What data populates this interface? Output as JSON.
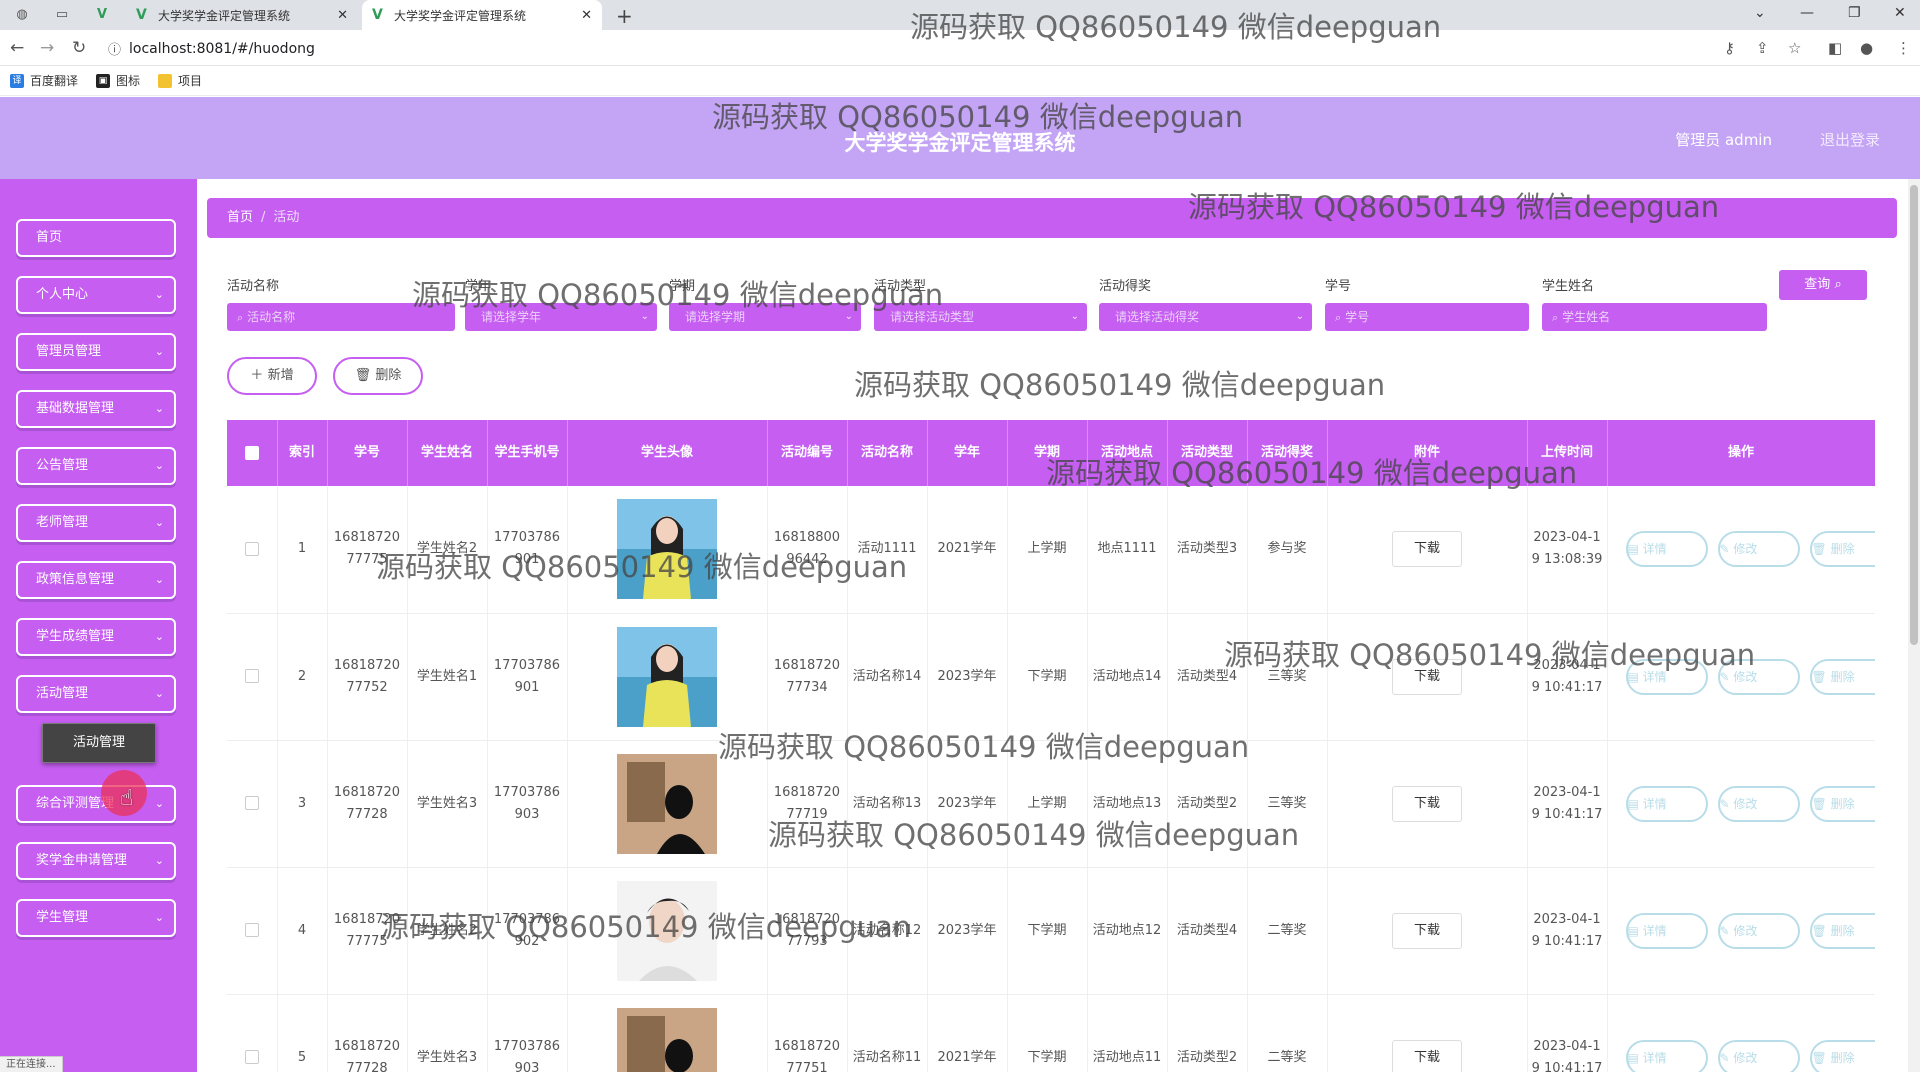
{
  "browser": {
    "tabs": [
      {
        "title": "大学奖学金评定管理系统",
        "close": "✕"
      },
      {
        "title": "大学奖学金评定管理系统",
        "close": "✕"
      }
    ],
    "new_tab": "+",
    "url": "localhost:8081/#/huodong",
    "bookmarks": [
      "百度翻译",
      "图标",
      "项目"
    ]
  },
  "header": {
    "title": "大学奖学金评定管理系统",
    "user": "管理员 admin",
    "logout": "退出登录"
  },
  "sidebar": {
    "items": [
      "首页",
      "个人中心",
      "管理员管理",
      "基础数据管理",
      "公告管理",
      "老师管理",
      "政策信息管理",
      "学生成绩管理",
      "活动管理",
      "综合评测管理",
      "奖学金申请管理",
      "学生管理"
    ],
    "submenu": "活动管理"
  },
  "breadcrumb": {
    "home": "首页",
    "separator": "/",
    "current": "活动"
  },
  "filters": {
    "labels": [
      "活动名称",
      "学年",
      "学期",
      "活动类型",
      "活动得奖",
      "学号",
      "学生姓名"
    ],
    "placeholders": [
      "活动名称",
      "请选择学年",
      "请选择学期",
      "请选择活动类型",
      "请选择活动得奖",
      "学号",
      "学生姓名"
    ],
    "query": "查询"
  },
  "actions": {
    "add": "新增",
    "delete": "删除"
  },
  "table": {
    "headers": [
      "索引",
      "学号",
      "学生姓名",
      "学生手机号",
      "学生头像",
      "活动编号",
      "活动名称",
      "学年",
      "学期",
      "活动地点",
      "活动类型",
      "活动得奖",
      "附件",
      "上传时间",
      "操作"
    ],
    "download_label": "下载",
    "op_labels": [
      "详情",
      "修改",
      "删除"
    ],
    "rows": [
      {
        "index": "1",
        "student_no": "1681872077775",
        "student_name": "学生姓名2",
        "phone": "17703786901",
        "activity_no": "1681880096442",
        "activity_name": "活动1111",
        "year": "2021学年",
        "term": "上学期",
        "place": "地点1111",
        "type": "活动类型3",
        "award": "参与奖",
        "time": "2023-04-19 13:08:39"
      },
      {
        "index": "2",
        "student_no": "1681872077752",
        "student_name": "学生姓名1",
        "phone": "17703786901",
        "activity_no": "1681872077734",
        "activity_name": "活动名称14",
        "year": "2023学年",
        "term": "下学期",
        "place": "活动地点14",
        "type": "活动类型4",
        "award": "三等奖",
        "time": "2023-04-19 10:41:17"
      },
      {
        "index": "3",
        "student_no": "1681872077728",
        "student_name": "学生姓名3",
        "phone": "17703786903",
        "activity_no": "1681872077719",
        "activity_name": "活动名称13",
        "year": "2023学年",
        "term": "上学期",
        "place": "活动地点13",
        "type": "活动类型2",
        "award": "三等奖",
        "time": "2023-04-19 10:41:17"
      },
      {
        "index": "4",
        "student_no": "1681872077775",
        "student_name": "学生姓名2",
        "phone": "17703786902",
        "activity_no": "1681872077793",
        "activity_name": "活动名称12",
        "year": "2023学年",
        "term": "下学期",
        "place": "活动地点12",
        "type": "活动类型4",
        "award": "二等奖",
        "time": "2023-04-19 10:41:17"
      },
      {
        "index": "5",
        "student_no": "1681872077728",
        "student_name": "学生姓名3",
        "phone": "17703786903",
        "activity_no": "1681872077751",
        "activity_name": "活动名称11",
        "year": "2021学年",
        "term": "下学期",
        "place": "活动地点11",
        "type": "活动类型2",
        "award": "二等奖",
        "time": "2023-04-19 10:41:17"
      }
    ]
  },
  "status_bar": "正在连接...",
  "watermark": "源码获取 QQ86050149 微信deepguan",
  "colors": {
    "primary": "#c55ef1",
    "header": "#c4a5f5",
    "op_border": "#b8dde8"
  }
}
